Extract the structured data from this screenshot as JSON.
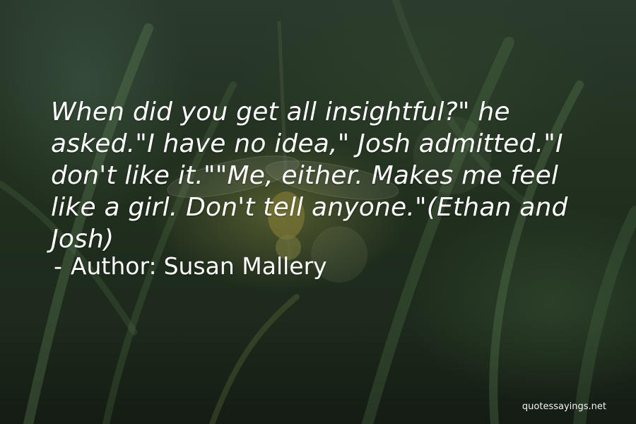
{
  "quote": {
    "text": "When did you get all insightful?\" he asked.\"I have no idea,\" Josh admitted.\"I don't like it.\"\"Me, either. Makes me feel like a girl. Don't tell anyone.\"(Ethan and Josh)",
    "dash": "-",
    "author_label": "Author:",
    "author_name": "Susan Mallery"
  },
  "watermark": {
    "text": "quotessayings.net"
  },
  "background": {
    "subject": "dragonfly on grass blades",
    "dominant_color": "#22301f",
    "text_color": "#ffffff"
  }
}
